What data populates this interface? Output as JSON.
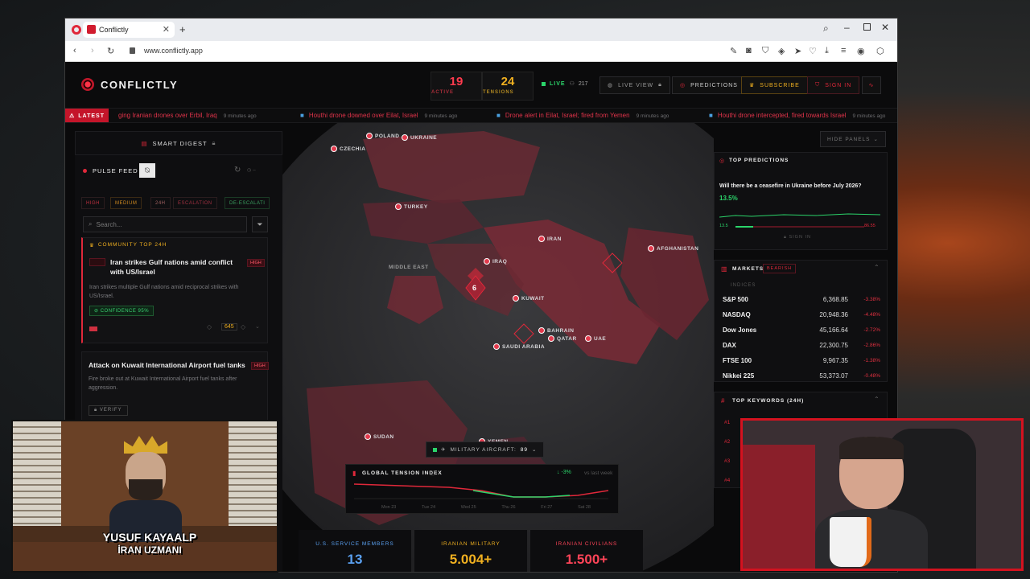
{
  "browser": {
    "tab_title": "Conflictly",
    "url": "www.conflictly.app"
  },
  "header": {
    "brand": "CONFLICTLY",
    "active_count": "19",
    "active_label": "ACTIVE",
    "tensions_count": "24",
    "tensions_label": "TENSIONS",
    "live_label": "LIVE",
    "viewers": "217",
    "live_view_label": "LIVE VIEW",
    "predictions_label": "PREDICTIONS",
    "subscribe_label": "SUBSCRIBE",
    "sign_in_label": "SIGN IN"
  },
  "ticker": {
    "latest_label": "LATEST",
    "items": [
      {
        "text": "ging Iranian drones over Erbil, Iraq",
        "ago": "9 minutes ago"
      },
      {
        "text": "Houthi drone downed over Eilat, Israel",
        "ago": "9 minutes ago"
      },
      {
        "text": "Drone alert in Eilat, Israel; fired from Yemen",
        "ago": "9 minutes ago"
      },
      {
        "text": "Houthi drone intercepted, fired towards Israel",
        "ago": "9 minutes ago"
      }
    ]
  },
  "left_panel": {
    "smart_digest": "SMART DIGEST",
    "pulse_feed": "PULSE FEED",
    "chips": [
      "HIGH",
      "MEDIUM",
      "24H",
      "ESCALATION",
      "DE-ESCALATI"
    ],
    "search_placeholder": "Search...",
    "community_top": "COMMUNITY TOP 24H",
    "card1": {
      "title": "Iran strikes Gulf nations amid conflict with US/Israel",
      "badge": "HIGH",
      "desc": "Iran strikes multiple Gulf nations amid reciprocal strikes with US/Israel.",
      "confidence": "CONFIDENCE 95%",
      "votes": "645"
    },
    "card2": {
      "title": "Attack on Kuwait International Airport fuel tanks",
      "badge": "HIGH",
      "desc": "Fire broke out at Kuwait International Airport fuel tanks after aggression.",
      "verify": "VERIFY"
    }
  },
  "map": {
    "labels": {
      "poland": "POLAND",
      "ukraine": "UKRAINE",
      "czechia": "CZECHIA",
      "turkey": "TURKEY",
      "iran": "IRAN",
      "iraq": "IRAQ",
      "afghanistan": "AFGHANISTAN",
      "middle_east": "MIDDLE EAST",
      "kuwait": "KUWAIT",
      "bahrain": "BAHRAIN",
      "qatar": "QATAR",
      "uae": "UAE",
      "saudi": "SAUDI ARABIA",
      "sudan": "SUDAN",
      "yemen": "YEMEN"
    },
    "cluster_count": "6",
    "military_aircraft_label": "MILITARY AIRCRAFT:",
    "military_aircraft_count": "89",
    "tension_index": {
      "title": "GLOBAL TENSION INDEX",
      "change": "-3%",
      "vs": "vs last week",
      "x_labels": [
        "Mon 23",
        "Tue 24",
        "Wed 25",
        "Thu 26",
        "Fri 27",
        "Sat 28"
      ]
    }
  },
  "right_panel": {
    "hide_panels": "HIDE PANELS",
    "top_predictions": "TOP PREDICTIONS",
    "prediction_question": "Will there be a ceasefire in Ukraine before July 2026?",
    "prediction_pct": "13.5%",
    "yes_pct": "13.5",
    "no_pct": "86.55",
    "sign_in": "SIGN IN",
    "markets_label": "MARKETS",
    "bearish": "BEARISH",
    "indices_label": "INDICES",
    "markets": [
      {
        "name": "S&P 500",
        "value": "6,368.85",
        "change": "-3.38%"
      },
      {
        "name": "NASDAQ",
        "value": "20,948.36",
        "change": "-4.48%"
      },
      {
        "name": "Dow Jones",
        "value": "45,166.64",
        "change": "-2.72%"
      },
      {
        "name": "DAX",
        "value": "22,300.75",
        "change": "-2.86%"
      },
      {
        "name": "FTSE 100",
        "value": "9,967.35",
        "change": "-1.38%"
      },
      {
        "name": "Nikkei 225",
        "value": "53,373.07",
        "change": "-0.48%"
      }
    ],
    "top_keywords": "TOP KEYWORDS (24H)",
    "keyword_ranks": [
      "#1",
      "#2",
      "#3",
      "#4"
    ]
  },
  "bottom_stats": [
    {
      "label": "U.S. SERVICE MEMBERS",
      "value": "13",
      "color": "#5aa0f0"
    },
    {
      "label": "IRANIAN MILITARY",
      "value": "5.004+",
      "color": "#f0b020"
    },
    {
      "label": "IRANIAN CIVILIANS",
      "value": "1.500+",
      "color": "#ff4458"
    }
  ],
  "webcam_left": {
    "name_line1": "YUSUF KAYAALP",
    "name_line2": "İRAN UZMANI"
  },
  "colors": {
    "accent_red": "#c4152a",
    "active_red": "#ff3b4e",
    "tension_yellow": "#f0b020"
  }
}
